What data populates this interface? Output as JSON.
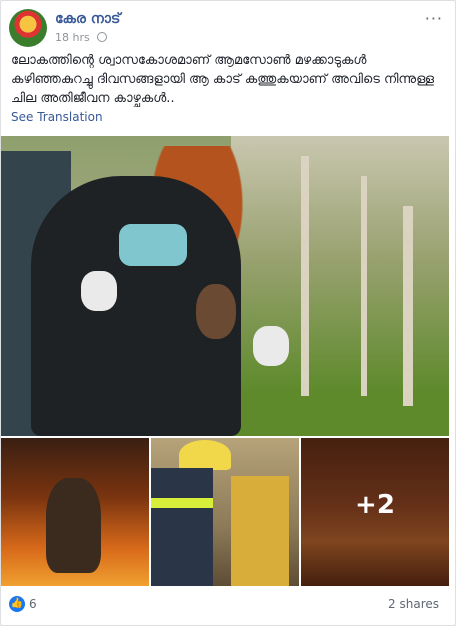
{
  "post": {
    "page_name": "കേര നാട്",
    "time": "18 hrs",
    "more_icon": "···",
    "text": "ലോകത്തിന്റെ ശ്വാസകോശമാണ് ആമസോൺ മഴക്കാടുകൾ കഴിഞ്ഞകുറച്ചു ദിവസങ്ങളായി ആ കാട് കത്തുകയാണ് അവിടെ നിന്നുള്ള ചില അതിജീവന കാഴ്ചകൾ..",
    "translate_label": "See Translation",
    "more_photos": "+2",
    "likes": "6",
    "shares": "2 shares"
  }
}
